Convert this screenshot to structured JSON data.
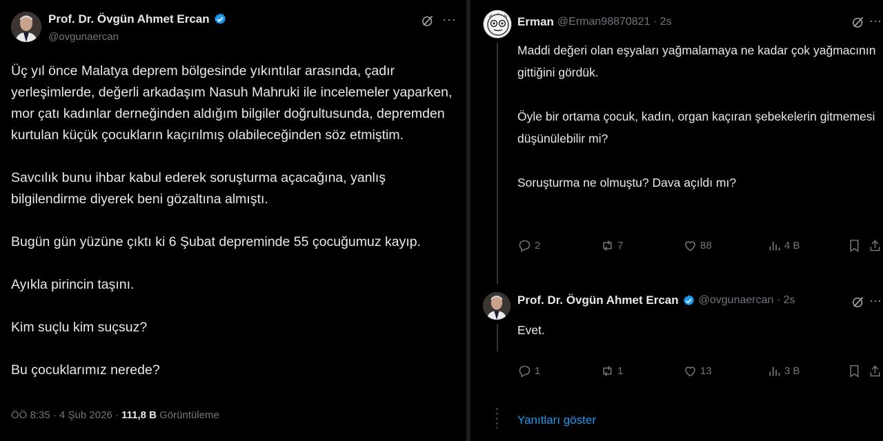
{
  "main_tweet": {
    "author_name": "Prof. Dr. Övgün Ahmet Ercan",
    "handle": "@ovgunaercan",
    "paragraphs": [
      "Üç yıl önce Malatya deprem bölgesinde yıkıntılar arasında, çadır yerleşimlerde, değerli arkadaşım Nasuh Mahruki ile incelemeler yaparken, mor çatı kadınlar derneğinden aldığım bilgiler doğrultusunda, depremden kurtulan küçük çocukların kaçırılmış olabileceğinden söz etmiştim.",
      "Savcılık bunu ihbar kabul ederek soruşturma açacağına, yanlış bilgilendirme diyerek beni gözaltına almıştı.",
      "Bugün gün yüzüne çıktı ki 6 Şubat depreminde 55 çocuğumuz kayıp.",
      "Ayıkla pirincin taşını.",
      "Kim suçlu kim suçsuz?",
      "Bu çocuklarımız nerede?"
    ],
    "timestamp": "ÖÖ 8:35 · 4 Şub 2026 ·",
    "views_count": "111,8 B",
    "views_label": "Görüntüleme",
    "more_label": "···"
  },
  "replies": [
    {
      "author_name": "Erman",
      "handle_time": "@Erman98870821 · 2s",
      "paragraphs": [
        "Maddi değeri olan eşyaları yağmalamaya ne kadar çok yağmacının gittiğini gördük.",
        "Öyle bir ortama çocuk, kadın, organ kaçıran şebekelerin gitmemesi düşünülebilir mi?",
        "Soruşturma ne olmuştu? Dava açıldı mı?"
      ],
      "replies_count": "2",
      "reposts_count": "7",
      "likes_count": "88",
      "views_count": "4 B",
      "more_label": "···"
    },
    {
      "author_name": "Prof. Dr. Övgün Ahmet Ercan",
      "handle_time": "@ovgunaercan · 2s",
      "paragraphs": [
        "Evet."
      ],
      "replies_count": "1",
      "reposts_count": "1",
      "likes_count": "13",
      "views_count": "3 B",
      "more_label": "···"
    }
  ],
  "show_replies_label": "Yanıtları göster",
  "colors": {
    "background": "#000000",
    "text": "#e7e9ea",
    "secondary_text": "#71767b",
    "accent": "#1d9bf0",
    "verified": "#1d9bf0"
  },
  "icons": [
    "verified-badge-icon",
    "grok-icon",
    "more-icon",
    "reply-icon",
    "repost-icon",
    "like-icon",
    "views-icon",
    "bookmark-icon",
    "share-icon"
  ]
}
